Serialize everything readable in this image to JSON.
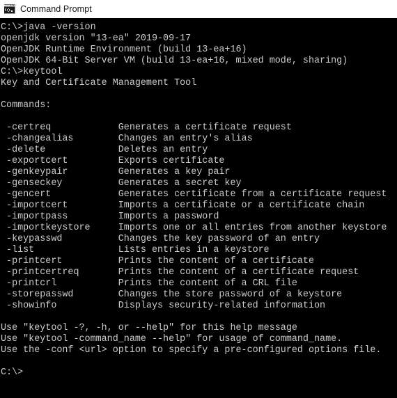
{
  "window": {
    "title": "Command Prompt",
    "icon": "console-icon",
    "titlebar_bg": "#ffffff",
    "title_color": "#10151c"
  },
  "terminal": {
    "background": "#000000",
    "foreground": "#cccccc",
    "columns": 70,
    "rows": 34,
    "prompt": "C:\\>",
    "blocks": [
      {
        "name": "java-version-command",
        "command_line": "C:\\>java -version",
        "output": [
          "openjdk version \"13-ea\" 2019-09-17",
          "OpenJDK Runtime Environment (build 13-ea+16)",
          "OpenJDK 64-Bit Server VM (build 13-ea+16, mixed mode, sharing)"
        ]
      },
      {
        "name": "keytool-command",
        "command_line": "C:\\>keytool",
        "output": [
          "Key and Certificate Management Tool",
          "",
          "Commands:",
          ""
        ]
      }
    ],
    "commands_heading": "Commands:",
    "commands": [
      {
        "name": "-certreq",
        "description": "Generates a certificate request"
      },
      {
        "name": "-changealias",
        "description": "Changes an entry's alias"
      },
      {
        "name": "-delete",
        "description": "Deletes an entry"
      },
      {
        "name": "-exportcert",
        "description": "Exports certificate"
      },
      {
        "name": "-genkeypair",
        "description": "Generates a key pair"
      },
      {
        "name": "-genseckey",
        "description": "Generates a secret key"
      },
      {
        "name": "-gencert",
        "description": "Generates certificate from a certificate request"
      },
      {
        "name": "-importcert",
        "description": "Imports a certificate or a certificate chain"
      },
      {
        "name": "-importpass",
        "description": "Imports a password"
      },
      {
        "name": "-importkeystore",
        "description": "Imports one or all entries from another keystore"
      },
      {
        "name": "-keypasswd",
        "description": "Changes the key password of an entry"
      },
      {
        "name": "-list",
        "description": "Lists entries in a keystore"
      },
      {
        "name": "-printcert",
        "description": "Prints the content of a certificate"
      },
      {
        "name": "-printcertreq",
        "description": "Prints the content of a certificate request"
      },
      {
        "name": "-printcrl",
        "description": "Prints the content of a CRL file"
      },
      {
        "name": "-storepasswd",
        "description": "Changes the store password of a keystore"
      },
      {
        "name": "-showinfo",
        "description": "Displays security-related information"
      }
    ],
    "usage_notes": [
      "Use \"keytool -?, -h, or --help\" for this help message",
      "Use \"keytool -command_name --help\" for usage of command_name.",
      "Use the -conf <url> option to specify a pre-configured options file."
    ],
    "final_prompt": "C:\\>"
  }
}
